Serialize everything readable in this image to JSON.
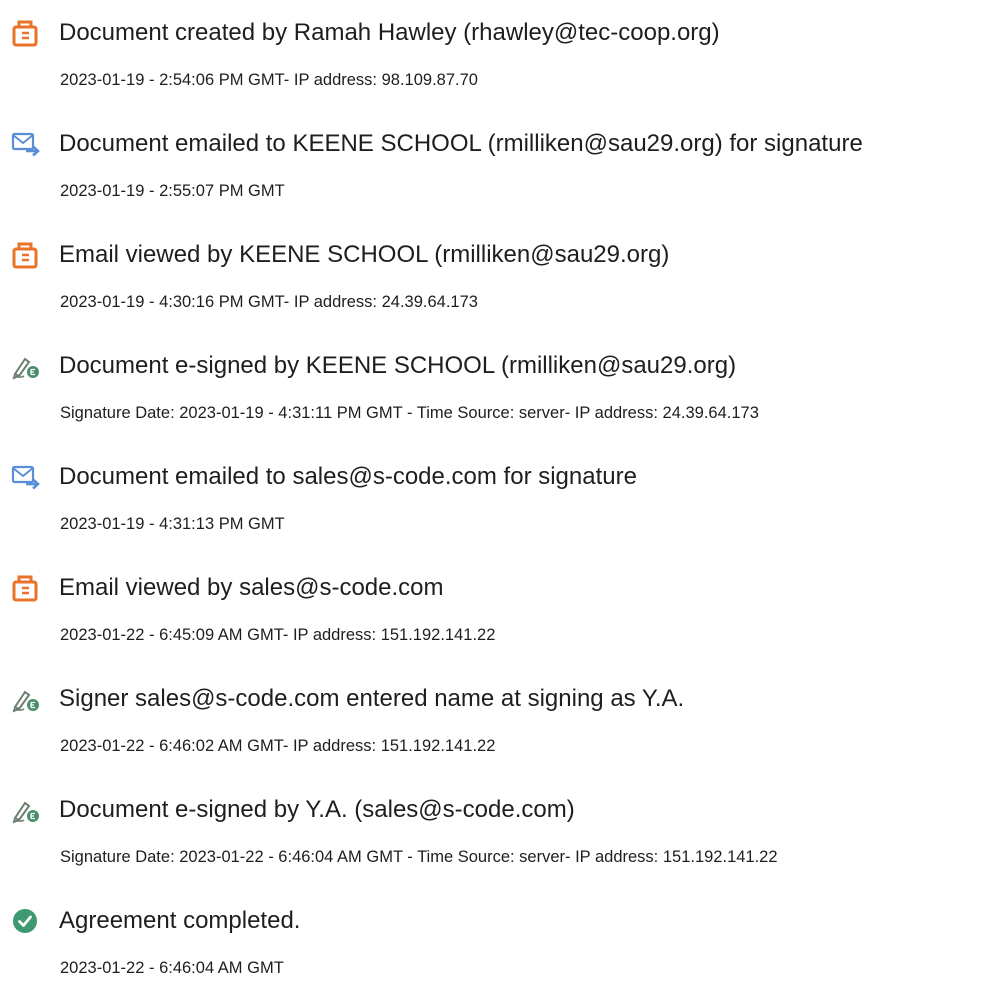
{
  "colors": {
    "created_icon": "#e8732a",
    "email_icon": "#5a8fd8",
    "signed_icon": "#4a8f6a",
    "completed_icon": "#3d9970",
    "text": "#1e1e1e"
  },
  "events": [
    {
      "icon": "document-created-icon",
      "title": "Document created by Ramah Hawley (rhawley@tec-coop.org)",
      "detail": "2023-01-19 - 2:54:06 PM GMT- IP address: 98.109.87.70"
    },
    {
      "icon": "email-sent-icon",
      "title": "Document emailed to KEENE SCHOOL (rmilliken@sau29.org) for signature",
      "detail": "2023-01-19 - 2:55:07 PM GMT"
    },
    {
      "icon": "email-viewed-icon",
      "title": "Email viewed by KEENE SCHOOL (rmilliken@sau29.org)",
      "detail": "2023-01-19 - 4:30:16 PM GMT- IP address: 24.39.64.173"
    },
    {
      "icon": "e-sign-icon",
      "title": "Document e-signed by KEENE SCHOOL (rmilliken@sau29.org)",
      "detail": "Signature Date: 2023-01-19 - 4:31:11 PM GMT - Time Source: server- IP address: 24.39.64.173"
    },
    {
      "icon": "email-sent-icon",
      "title": "Document emailed to sales@s-code.com for signature",
      "detail": "2023-01-19 - 4:31:13 PM GMT"
    },
    {
      "icon": "email-viewed-icon",
      "title": "Email viewed by sales@s-code.com",
      "detail": "2023-01-22 - 6:45:09 AM GMT- IP address: 151.192.141.22"
    },
    {
      "icon": "e-sign-icon",
      "title": "Signer sales@s-code.com entered name at signing as Y.A.",
      "detail": "2023-01-22 - 6:46:02 AM GMT- IP address: 151.192.141.22"
    },
    {
      "icon": "e-sign-icon",
      "title": "Document e-signed by Y.A. (sales@s-code.com)",
      "detail": "Signature Date: 2023-01-22 - 6:46:04 AM GMT - Time Source: server- IP address: 151.192.141.22"
    },
    {
      "icon": "check-circle-icon",
      "title": "Agreement completed.",
      "detail": "2023-01-22 - 6:46:04 AM GMT"
    }
  ]
}
